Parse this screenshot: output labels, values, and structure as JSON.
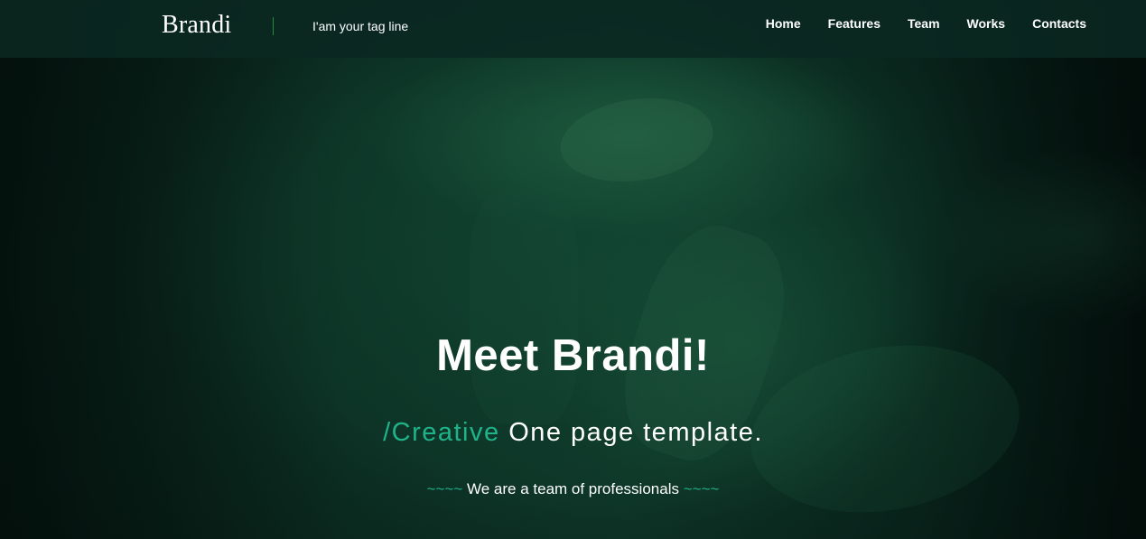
{
  "header": {
    "logo": "Brandi",
    "tagline": "I'am your tag line",
    "nav": [
      "Home",
      "Features",
      "Team",
      "Works",
      "Contacts"
    ]
  },
  "hero": {
    "title": "Meet Brandi!",
    "subtitle_accent": "/Creative",
    "subtitle_rest": "One page template.",
    "team_tilde_left": "~~~~",
    "team_text": "We are a team of professionals",
    "team_tilde_right": "~~~~"
  },
  "colors": {
    "accent": "#1fb38a",
    "navbar_bg": "#0a2821",
    "divider": "#1f8f3f"
  }
}
